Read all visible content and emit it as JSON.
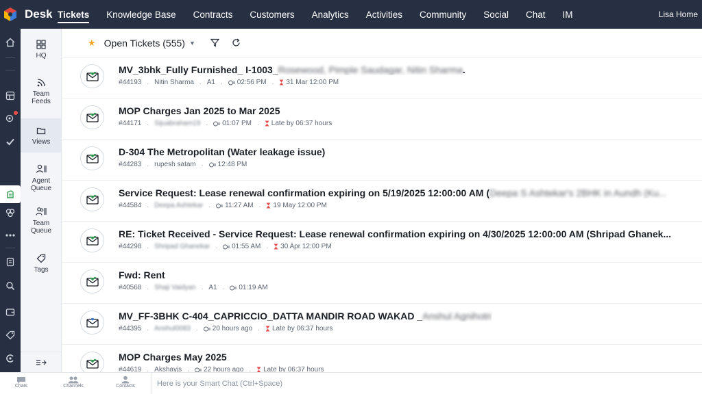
{
  "app": {
    "title": "Desk"
  },
  "nav": {
    "items": [
      {
        "label": "Tickets",
        "active": true
      },
      {
        "label": "Knowledge Base"
      },
      {
        "label": "Contracts"
      },
      {
        "label": "Customers"
      },
      {
        "label": "Analytics"
      },
      {
        "label": "Activities"
      },
      {
        "label": "Community"
      },
      {
        "label": "Social"
      },
      {
        "label": "Chat"
      },
      {
        "label": "IM"
      }
    ],
    "user": "Lisa Home"
  },
  "sidebar": {
    "items": [
      {
        "label": "HQ",
        "icon": "grid-icon"
      },
      {
        "label": "Team Feeds",
        "icon": "rss-icon"
      },
      {
        "label": "Views",
        "icon": "folder-icon",
        "selected": true
      },
      {
        "label": "Agent Queue",
        "icon": "agent-queue-icon"
      },
      {
        "label": "Team Queue",
        "icon": "team-queue-icon"
      },
      {
        "label": "Tags",
        "icon": "tag-icon"
      }
    ]
  },
  "list_header": {
    "view_title": "Open Tickets (555)"
  },
  "tickets": [
    {
      "subject": "MV_3bhk_Fully Furnished_ I-1003_",
      "subject_blur": "Rosewood, Pimple Saudagar, Nitin Sharma",
      "subject_tail": ".",
      "id": "#44193",
      "contact": "Nitin Sharma",
      "contact_blur": false,
      "tag": "A1",
      "time": "02:56 PM",
      "due": "31 Mar 12:00 PM"
    },
    {
      "subject": "MOP Charges Jan 2025 to Mar 2025",
      "id": "#44171",
      "contact": "Sijuabraham19",
      "contact_blur": true,
      "time": "01:07 PM",
      "due": "Late by 06:37 hours"
    },
    {
      "subject": "D-304 The Metropolitan (Water leakage issue)",
      "id": "#44283",
      "contact": "rupesh satam",
      "contact_blur": false,
      "time": "12:48 PM"
    },
    {
      "subject": "Service Request: Lease renewal confirmation expiring on 5/19/2025 12:00:00 AM (",
      "subject_blur": "Deepa S Ashtekar's 2BHK in Aundh (Ku...",
      "id": "#44584",
      "contact": "Deepa Ashtekar",
      "contact_blur": true,
      "time": "11:27 AM",
      "due": "19 May 12:00 PM"
    },
    {
      "subject": "RE: Ticket Received - Service Request: Lease renewal confirmation expiring on 4/30/2025 12:00:00 AM (Shripad Ghanek...",
      "id": "#44298",
      "contact": "Shripad Ghanekar",
      "contact_blur": true,
      "time": "01:55 AM",
      "due": "30 Apr 12:00 PM"
    },
    {
      "subject": "Fwd: Rent",
      "id": "#40568",
      "contact": "Shaji Vaidyan",
      "contact_blur": true,
      "tag": "A1",
      "time": "01:19 AM"
    },
    {
      "subject": "MV_FF-3BHK C-404_CAPRICCIO_DATTA MANDIR ROAD WAKAD _",
      "subject_blur": "Anshul Agnihotri",
      "id": "#44395",
      "contact": "Anshul0083",
      "contact_blur": true,
      "time": "20 hours ago",
      "due": "Late by 06:37 hours"
    },
    {
      "subject": "MOP Charges May 2025",
      "id": "#44619",
      "contact": "Akshayjs",
      "contact_blur": false,
      "time": "22 hours ago",
      "due": "Late by 06:37 hours"
    }
  ],
  "bottom": {
    "items": [
      "Chats",
      "Channels",
      "Contacts"
    ],
    "smart_chat_placeholder": "Here is your Smart Chat (Ctrl+Space)"
  },
  "colors": {
    "topbar": "#273042",
    "accent_green": "#2e9e4f",
    "star": "#f5a623",
    "late_red": "#e84b4b"
  }
}
